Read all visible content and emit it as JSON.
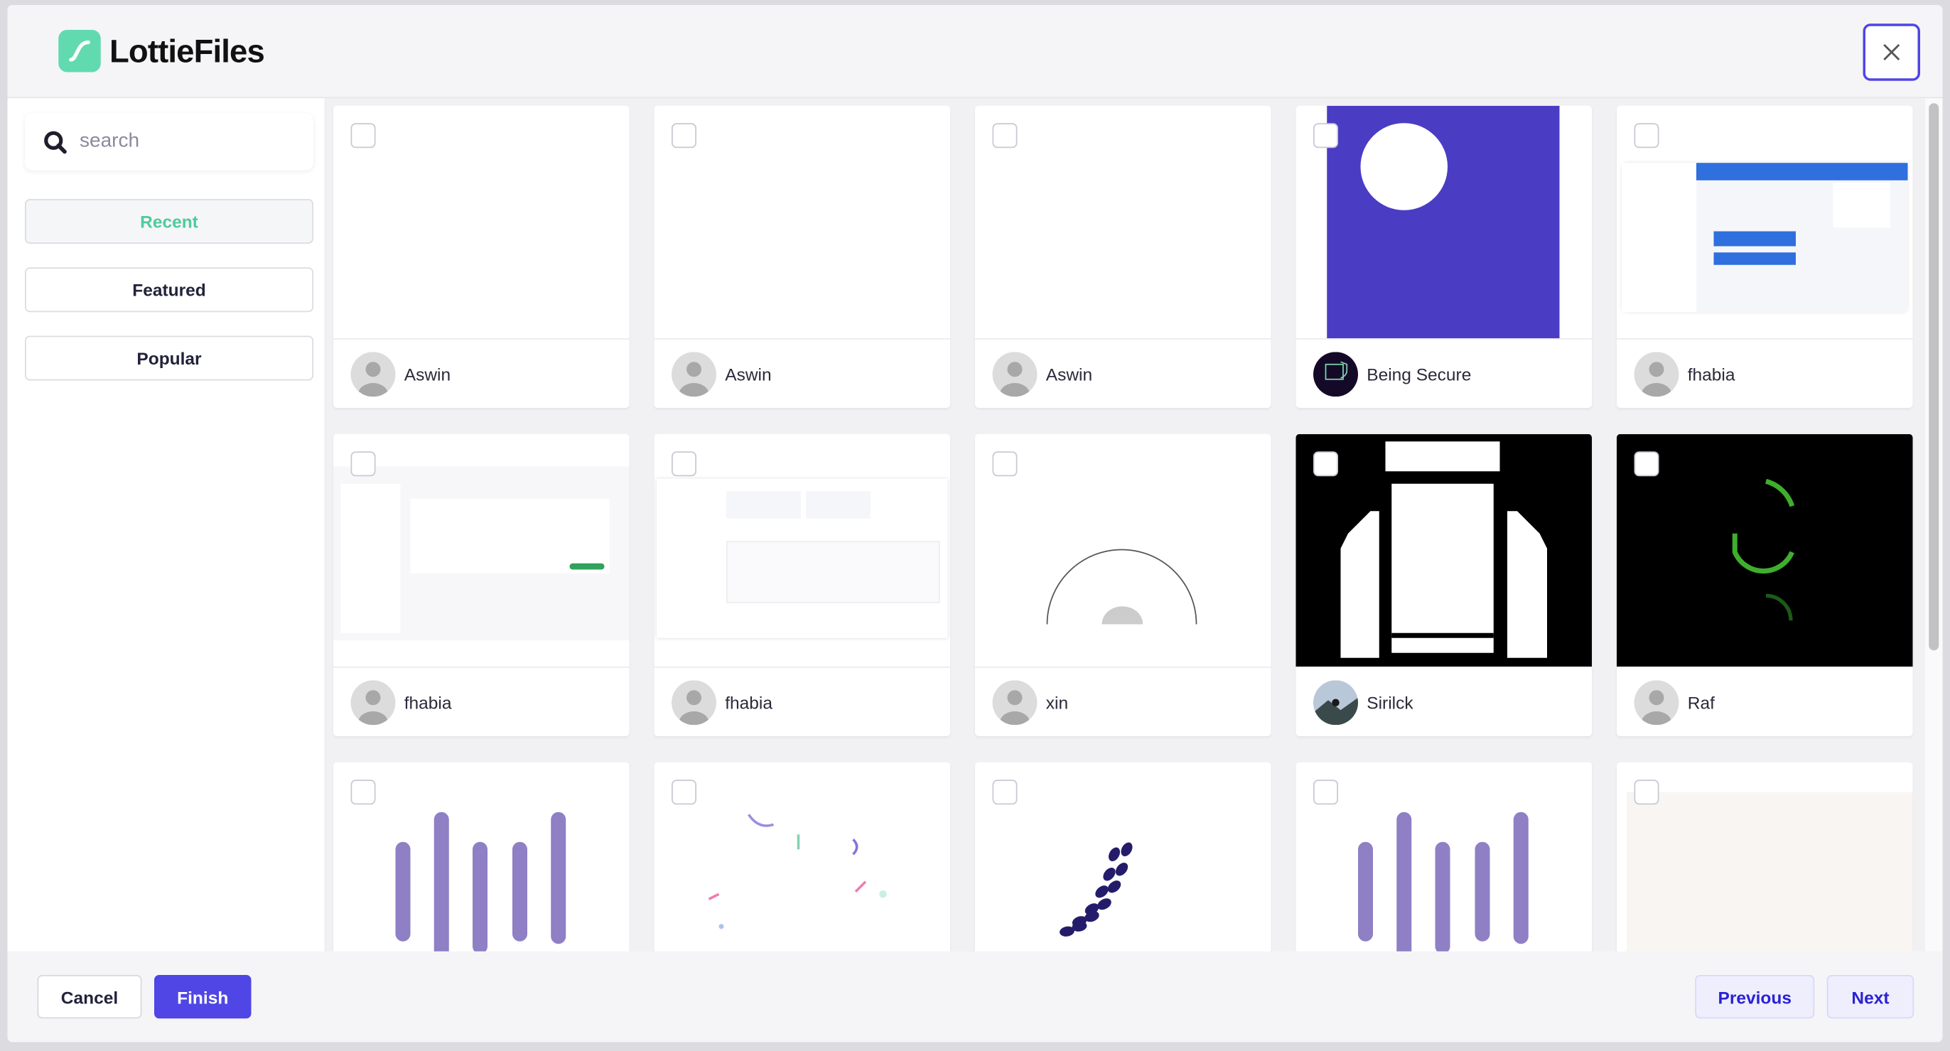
{
  "header": {
    "brand": "LottieFiles",
    "close_icon": "close-icon"
  },
  "sidebar": {
    "search_placeholder": "search",
    "search_value": "",
    "items": [
      {
        "label": "Recent",
        "active": true
      },
      {
        "label": "Featured",
        "active": false
      },
      {
        "label": "Popular",
        "active": false
      }
    ]
  },
  "colors": {
    "accent": "#4f46e5",
    "brand": "#62dab0",
    "active_text": "#4ecb9a"
  },
  "cards": [
    {
      "author": "Aswin",
      "preview": "blank",
      "avatar": "default"
    },
    {
      "author": "Aswin",
      "preview": "blank",
      "avatar": "default"
    },
    {
      "author": "Aswin",
      "preview": "blank",
      "avatar": "default"
    },
    {
      "author": "Being Secure",
      "preview": "purple-circle",
      "avatar": "being-secure"
    },
    {
      "author": "fhabia",
      "preview": "dashboard",
      "avatar": "default"
    },
    {
      "author": "fhabia",
      "preview": "monthly-report",
      "avatar": "default"
    },
    {
      "author": "fhabia",
      "preview": "financial-report",
      "avatar": "default"
    },
    {
      "author": "xin",
      "preview": "semicircle",
      "avatar": "default"
    },
    {
      "author": "Sirilck",
      "preview": "black-shapes",
      "avatar": "photo"
    },
    {
      "author": "Raf",
      "preview": "green-loader",
      "avatar": "default"
    },
    {
      "author": "",
      "preview": "purple-bars",
      "avatar": "default"
    },
    {
      "author": "",
      "preview": "confetti",
      "avatar": "default"
    },
    {
      "author": "",
      "preview": "footsteps",
      "avatar": "default"
    },
    {
      "author": "",
      "preview": "purple-bars",
      "avatar": "default"
    },
    {
      "author": "",
      "preview": "faint-chart",
      "avatar": "default"
    }
  ],
  "footer": {
    "cancel": "Cancel",
    "finish": "Finish",
    "previous": "Previous",
    "next": "Next"
  }
}
